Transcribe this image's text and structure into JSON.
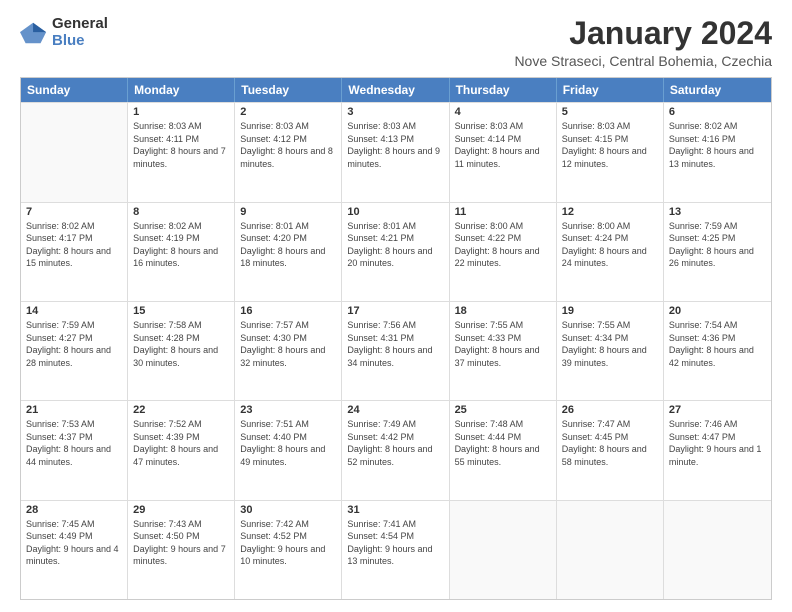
{
  "logo": {
    "general": "General",
    "blue": "Blue"
  },
  "title": "January 2024",
  "subtitle": "Nove Straseci, Central Bohemia, Czechia",
  "calendar": {
    "headers": [
      "Sunday",
      "Monday",
      "Tuesday",
      "Wednesday",
      "Thursday",
      "Friday",
      "Saturday"
    ],
    "weeks": [
      [
        {
          "day": "",
          "sunrise": "",
          "sunset": "",
          "daylight": ""
        },
        {
          "day": "1",
          "sunrise": "Sunrise: 8:03 AM",
          "sunset": "Sunset: 4:11 PM",
          "daylight": "Daylight: 8 hours and 7 minutes."
        },
        {
          "day": "2",
          "sunrise": "Sunrise: 8:03 AM",
          "sunset": "Sunset: 4:12 PM",
          "daylight": "Daylight: 8 hours and 8 minutes."
        },
        {
          "day": "3",
          "sunrise": "Sunrise: 8:03 AM",
          "sunset": "Sunset: 4:13 PM",
          "daylight": "Daylight: 8 hours and 9 minutes."
        },
        {
          "day": "4",
          "sunrise": "Sunrise: 8:03 AM",
          "sunset": "Sunset: 4:14 PM",
          "daylight": "Daylight: 8 hours and 11 minutes."
        },
        {
          "day": "5",
          "sunrise": "Sunrise: 8:03 AM",
          "sunset": "Sunset: 4:15 PM",
          "daylight": "Daylight: 8 hours and 12 minutes."
        },
        {
          "day": "6",
          "sunrise": "Sunrise: 8:02 AM",
          "sunset": "Sunset: 4:16 PM",
          "daylight": "Daylight: 8 hours and 13 minutes."
        }
      ],
      [
        {
          "day": "7",
          "sunrise": "Sunrise: 8:02 AM",
          "sunset": "Sunset: 4:17 PM",
          "daylight": "Daylight: 8 hours and 15 minutes."
        },
        {
          "day": "8",
          "sunrise": "Sunrise: 8:02 AM",
          "sunset": "Sunset: 4:19 PM",
          "daylight": "Daylight: 8 hours and 16 minutes."
        },
        {
          "day": "9",
          "sunrise": "Sunrise: 8:01 AM",
          "sunset": "Sunset: 4:20 PM",
          "daylight": "Daylight: 8 hours and 18 minutes."
        },
        {
          "day": "10",
          "sunrise": "Sunrise: 8:01 AM",
          "sunset": "Sunset: 4:21 PM",
          "daylight": "Daylight: 8 hours and 20 minutes."
        },
        {
          "day": "11",
          "sunrise": "Sunrise: 8:00 AM",
          "sunset": "Sunset: 4:22 PM",
          "daylight": "Daylight: 8 hours and 22 minutes."
        },
        {
          "day": "12",
          "sunrise": "Sunrise: 8:00 AM",
          "sunset": "Sunset: 4:24 PM",
          "daylight": "Daylight: 8 hours and 24 minutes."
        },
        {
          "day": "13",
          "sunrise": "Sunrise: 7:59 AM",
          "sunset": "Sunset: 4:25 PM",
          "daylight": "Daylight: 8 hours and 26 minutes."
        }
      ],
      [
        {
          "day": "14",
          "sunrise": "Sunrise: 7:59 AM",
          "sunset": "Sunset: 4:27 PM",
          "daylight": "Daylight: 8 hours and 28 minutes."
        },
        {
          "day": "15",
          "sunrise": "Sunrise: 7:58 AM",
          "sunset": "Sunset: 4:28 PM",
          "daylight": "Daylight: 8 hours and 30 minutes."
        },
        {
          "day": "16",
          "sunrise": "Sunrise: 7:57 AM",
          "sunset": "Sunset: 4:30 PM",
          "daylight": "Daylight: 8 hours and 32 minutes."
        },
        {
          "day": "17",
          "sunrise": "Sunrise: 7:56 AM",
          "sunset": "Sunset: 4:31 PM",
          "daylight": "Daylight: 8 hours and 34 minutes."
        },
        {
          "day": "18",
          "sunrise": "Sunrise: 7:55 AM",
          "sunset": "Sunset: 4:33 PM",
          "daylight": "Daylight: 8 hours and 37 minutes."
        },
        {
          "day": "19",
          "sunrise": "Sunrise: 7:55 AM",
          "sunset": "Sunset: 4:34 PM",
          "daylight": "Daylight: 8 hours and 39 minutes."
        },
        {
          "day": "20",
          "sunrise": "Sunrise: 7:54 AM",
          "sunset": "Sunset: 4:36 PM",
          "daylight": "Daylight: 8 hours and 42 minutes."
        }
      ],
      [
        {
          "day": "21",
          "sunrise": "Sunrise: 7:53 AM",
          "sunset": "Sunset: 4:37 PM",
          "daylight": "Daylight: 8 hours and 44 minutes."
        },
        {
          "day": "22",
          "sunrise": "Sunrise: 7:52 AM",
          "sunset": "Sunset: 4:39 PM",
          "daylight": "Daylight: 8 hours and 47 minutes."
        },
        {
          "day": "23",
          "sunrise": "Sunrise: 7:51 AM",
          "sunset": "Sunset: 4:40 PM",
          "daylight": "Daylight: 8 hours and 49 minutes."
        },
        {
          "day": "24",
          "sunrise": "Sunrise: 7:49 AM",
          "sunset": "Sunset: 4:42 PM",
          "daylight": "Daylight: 8 hours and 52 minutes."
        },
        {
          "day": "25",
          "sunrise": "Sunrise: 7:48 AM",
          "sunset": "Sunset: 4:44 PM",
          "daylight": "Daylight: 8 hours and 55 minutes."
        },
        {
          "day": "26",
          "sunrise": "Sunrise: 7:47 AM",
          "sunset": "Sunset: 4:45 PM",
          "daylight": "Daylight: 8 hours and 58 minutes."
        },
        {
          "day": "27",
          "sunrise": "Sunrise: 7:46 AM",
          "sunset": "Sunset: 4:47 PM",
          "daylight": "Daylight: 9 hours and 1 minute."
        }
      ],
      [
        {
          "day": "28",
          "sunrise": "Sunrise: 7:45 AM",
          "sunset": "Sunset: 4:49 PM",
          "daylight": "Daylight: 9 hours and 4 minutes."
        },
        {
          "day": "29",
          "sunrise": "Sunrise: 7:43 AM",
          "sunset": "Sunset: 4:50 PM",
          "daylight": "Daylight: 9 hours and 7 minutes."
        },
        {
          "day": "30",
          "sunrise": "Sunrise: 7:42 AM",
          "sunset": "Sunset: 4:52 PM",
          "daylight": "Daylight: 9 hours and 10 minutes."
        },
        {
          "day": "31",
          "sunrise": "Sunrise: 7:41 AM",
          "sunset": "Sunset: 4:54 PM",
          "daylight": "Daylight: 9 hours and 13 minutes."
        },
        {
          "day": "",
          "sunrise": "",
          "sunset": "",
          "daylight": ""
        },
        {
          "day": "",
          "sunrise": "",
          "sunset": "",
          "daylight": ""
        },
        {
          "day": "",
          "sunrise": "",
          "sunset": "",
          "daylight": ""
        }
      ]
    ]
  }
}
